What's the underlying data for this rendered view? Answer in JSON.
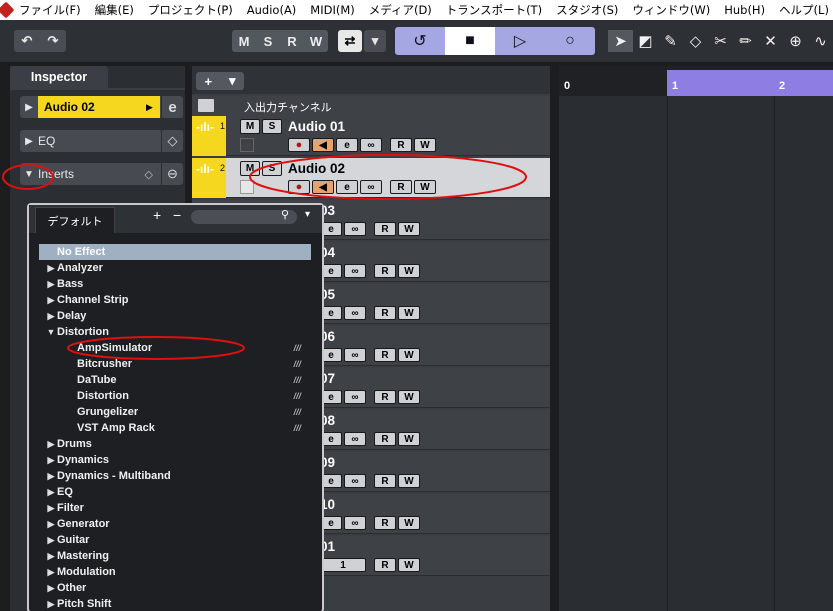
{
  "menubar": {
    "items": [
      "ファイル(F)",
      "編集(E)",
      "プロジェクト(P)",
      "Audio(A)",
      "MIDI(M)",
      "メディア(D)",
      "トランスポート(T)",
      "スタジオ(S)",
      "ウィンドウ(W)",
      "Hub(H)",
      "ヘルプ(L)"
    ]
  },
  "toolbar": {
    "undo_icon": "↶",
    "redo_icon": "↷",
    "mode_buttons": [
      "M",
      "S",
      "R",
      "W"
    ],
    "snap_icon": "⇄",
    "dropdown_icon": "▾",
    "transport": [
      "↺",
      "■",
      "▷",
      "○"
    ],
    "tools": [
      "➤",
      "◩",
      "✎",
      "◇",
      "✂",
      "✏",
      "✕",
      "⊕",
      "∿"
    ]
  },
  "inspector": {
    "tab_label": "Inspector",
    "track_name": "Audio 02",
    "edit_icon": "e",
    "eq_label": "EQ",
    "inserts_label": "Inserts",
    "expand_arrow": "▶",
    "collapse_arrow": "▼"
  },
  "tracklist": {
    "add_label": "+",
    "add_dropdown": "▾",
    "io_channel_label": "入出力チャンネル",
    "tracks": [
      {
        "num": "1",
        "name": "Audio 01"
      },
      {
        "num": "2",
        "name": "Audio 02"
      },
      {
        "num": "",
        "name": "03"
      },
      {
        "num": "",
        "name": "04"
      },
      {
        "num": "",
        "name": "05"
      },
      {
        "num": "",
        "name": "06"
      },
      {
        "num": "",
        "name": "07"
      },
      {
        "num": "",
        "name": "08"
      },
      {
        "num": "",
        "name": "09"
      },
      {
        "num": "",
        "name": "10"
      },
      {
        "num": "",
        "name": "01"
      }
    ],
    "m_label": "M",
    "s_label": "S",
    "r_label": "R",
    "w_label": "W",
    "e_label": "e",
    "link_label": "∞",
    "rec_label": "●",
    "mon_label": "◀",
    "midi_channel_label": "1"
  },
  "ruler": {
    "marks": [
      "0",
      "1",
      "2"
    ]
  },
  "popup": {
    "tab_label": "デフォルト",
    "plus": "+",
    "minus": "−",
    "search_icon": "⚲",
    "dropdown": "▾",
    "items": [
      {
        "label": "No Effect",
        "type": "selected"
      },
      {
        "label": "Analyzer",
        "type": "folder"
      },
      {
        "label": "Bass",
        "type": "folder"
      },
      {
        "label": "Channel Strip",
        "type": "folder"
      },
      {
        "label": "Delay",
        "type": "folder"
      },
      {
        "label": "Distortion",
        "type": "open"
      },
      {
        "label": "AmpSimulator",
        "type": "child"
      },
      {
        "label": "Bitcrusher",
        "type": "child"
      },
      {
        "label": "DaTube",
        "type": "child"
      },
      {
        "label": "Distortion",
        "type": "child"
      },
      {
        "label": "Grungelizer",
        "type": "child"
      },
      {
        "label": "VST Amp Rack",
        "type": "child"
      },
      {
        "label": "Drums",
        "type": "folder"
      },
      {
        "label": "Dynamics",
        "type": "folder"
      },
      {
        "label": "Dynamics - Multiband",
        "type": "folder"
      },
      {
        "label": "EQ",
        "type": "folder"
      },
      {
        "label": "Filter",
        "type": "folder"
      },
      {
        "label": "Generator",
        "type": "folder"
      },
      {
        "label": "Guitar",
        "type": "folder"
      },
      {
        "label": "Mastering",
        "type": "folder"
      },
      {
        "label": "Modulation",
        "type": "folder"
      },
      {
        "label": "Other",
        "type": "folder"
      },
      {
        "label": "Pitch Shift",
        "type": "folder"
      }
    ],
    "child_marker": "///"
  },
  "colors": {
    "track_yellow": "#f5d71f",
    "cycle_purple": "#8e7de2",
    "transport_blue": "#a4a7e2",
    "annotation_red": "#e01010"
  }
}
